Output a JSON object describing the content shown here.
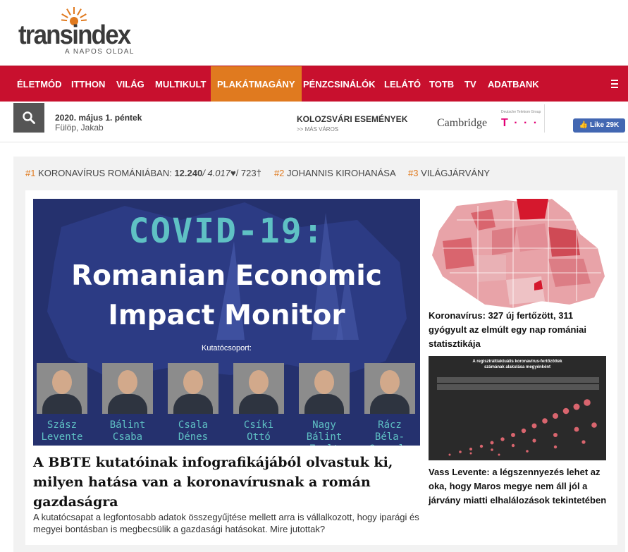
{
  "brand": {
    "logo_text": "transindex",
    "tagline": "A NAPOS OLDAL"
  },
  "nav": {
    "items": [
      {
        "label": "ÉLETMÓD"
      },
      {
        "label": "ITTHON"
      },
      {
        "label": "VILÁG"
      },
      {
        "label": "MULTIKULT"
      },
      {
        "label": "PLAKÁTMAGÁNY",
        "active": true
      },
      {
        "label": "PÉNZCSINÁLÓK"
      },
      {
        "label": "LELÁTÓ"
      },
      {
        "label": "TOTB"
      },
      {
        "label": "TV"
      },
      {
        "label": "ADATBANK"
      }
    ],
    "accent_color": "#c8102e",
    "active_color": "#e07a1f"
  },
  "infobar": {
    "date": "2020. május 1. péntek",
    "names": "Fülöp, Jakab",
    "events_title": "KOLOZSVÁRI ESEMÉNYEK",
    "events_sub": ">> MÁS VÁROS",
    "sponsor_cambridge": "Cambridge",
    "sponsor_telekom_label": "Deutsche Telekom Group",
    "sponsor_telekom_mark": "T · · ·",
    "like_label": "Like 29K"
  },
  "trending": {
    "t1_num": "#1",
    "t1_label": "KORONAVÍRUS ROMÁNIÁBAN:",
    "t1_cases": "12.240",
    "t1_recovered": "/ 4.017",
    "t1_heart": "♥",
    "t1_deaths": "/ 723†",
    "t2_num": "#2",
    "t2_label": "JOHANNIS KIROHANÁSA",
    "t3_num": "#3",
    "t3_label": "VILÁGJÁRVÁNY"
  },
  "main_article": {
    "image_title1": "COVID-19:",
    "image_title2": "Romanian Economic",
    "image_title3": "Impact Monitor",
    "image_group_label": "Kutatócsoport:",
    "people": [
      {
        "line1": "Szász",
        "line2": "Levente"
      },
      {
        "line1": "Bálint",
        "line2": "Csaba"
      },
      {
        "line1": "Csala",
        "line2": "Dénes"
      },
      {
        "line1": "Csíki",
        "line2": "Ottó"
      },
      {
        "line1": "Nagy",
        "line2": "Bálint Zsolt"
      },
      {
        "line1": "Rácz",
        "line2": "Béla-Gergely"
      }
    ],
    "headline": "A BBTE kutatóinak infografikájából olvastuk ki, milyen hatása van a koronavírusnak a román gazdaságra",
    "lead": "A kutatócsapat a legfontosabb adatok összegyűjtése mellett arra is vállalkozott, hogy iparági és megyei bontásban is megbecsülik a gazdasági hatásokat. Mire jutottak?"
  },
  "side_articles": [
    {
      "title": "Koronavírus: 327 új fertőzött, 311 gyógyult az elmúlt egy nap romániai statisztikája"
    },
    {
      "title": "Vass Levente: a légszennyezés lehet az oka, hogy Maros megye nem áll jól a járvány miatti elhalálozások tekintetében",
      "chart_title_a": "A regisztrált/aktuális koronavírus-fertőzöttek",
      "chart_title_b": "számának alakulása megyénként"
    }
  ]
}
